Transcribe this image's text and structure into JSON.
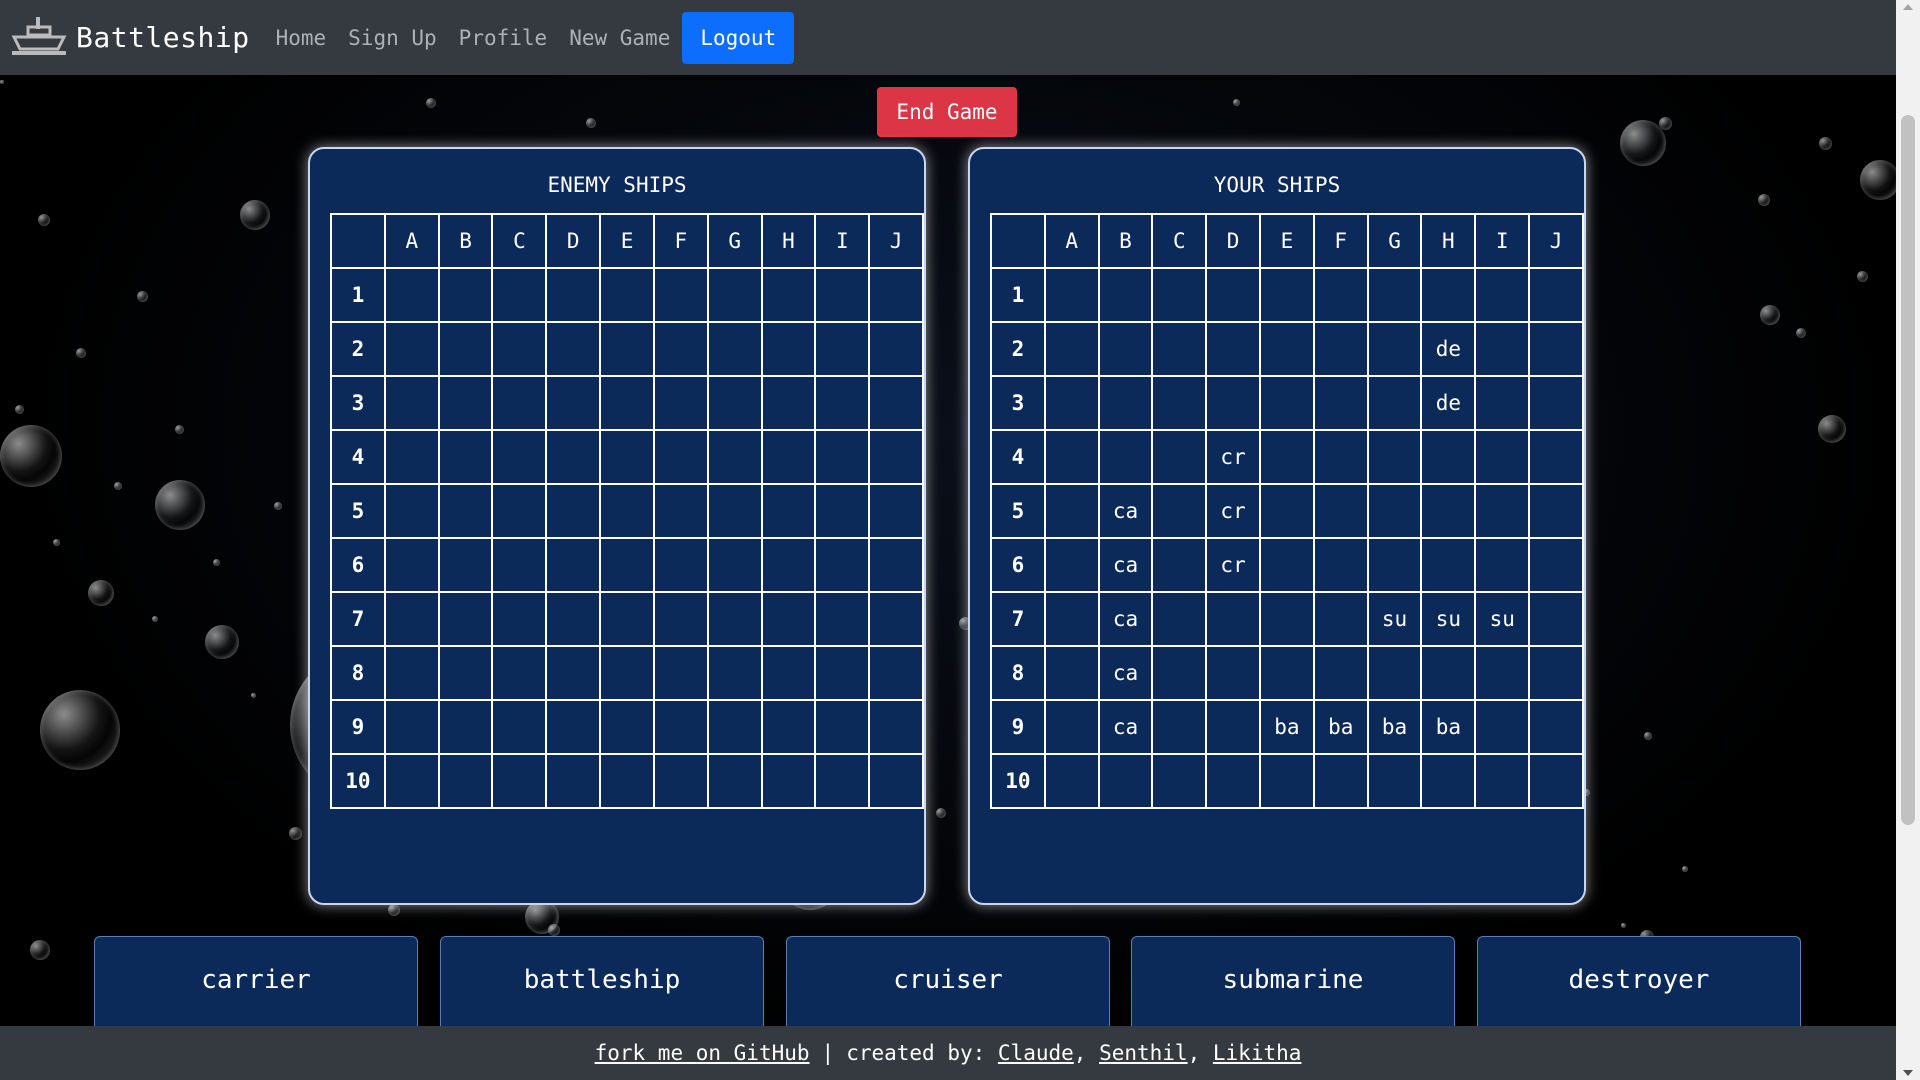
{
  "nav": {
    "brand": "Battleship",
    "links": [
      "Home",
      "Sign Up",
      "Profile",
      "New Game"
    ],
    "logout": "Logout"
  },
  "game": {
    "end_button": "End Game"
  },
  "boards": {
    "enemy": {
      "title": "ENEMY SHIPS",
      "columns": [
        "A",
        "B",
        "C",
        "D",
        "E",
        "F",
        "G",
        "H",
        "I",
        "J"
      ],
      "rows": [
        "1",
        "2",
        "3",
        "4",
        "5",
        "6",
        "7",
        "8",
        "9",
        "10"
      ],
      "cells": [
        [
          "",
          "",
          "",
          "",
          "",
          "",
          "",
          "",
          "",
          ""
        ],
        [
          "",
          "",
          "",
          "",
          "",
          "",
          "",
          "",
          "",
          ""
        ],
        [
          "",
          "",
          "",
          "",
          "",
          "",
          "",
          "",
          "",
          ""
        ],
        [
          "",
          "",
          "",
          "",
          "",
          "",
          "",
          "",
          "",
          ""
        ],
        [
          "",
          "",
          "",
          "",
          "",
          "",
          "",
          "",
          "",
          ""
        ],
        [
          "",
          "",
          "",
          "",
          "",
          "",
          "",
          "",
          "",
          ""
        ],
        [
          "",
          "",
          "",
          "",
          "",
          "",
          "",
          "",
          "",
          ""
        ],
        [
          "",
          "",
          "",
          "",
          "",
          "",
          "",
          "",
          "",
          ""
        ],
        [
          "",
          "",
          "",
          "",
          "",
          "",
          "",
          "",
          "",
          ""
        ],
        [
          "",
          "",
          "",
          "",
          "",
          "",
          "",
          "",
          "",
          ""
        ]
      ]
    },
    "yours": {
      "title": "YOUR SHIPS",
      "columns": [
        "A",
        "B",
        "C",
        "D",
        "E",
        "F",
        "G",
        "H",
        "I",
        "J"
      ],
      "rows": [
        "1",
        "2",
        "3",
        "4",
        "5",
        "6",
        "7",
        "8",
        "9",
        "10"
      ],
      "cells": [
        [
          "",
          "",
          "",
          "",
          "",
          "",
          "",
          "",
          "",
          ""
        ],
        [
          "",
          "",
          "",
          "",
          "",
          "",
          "",
          "de",
          "",
          ""
        ],
        [
          "",
          "",
          "",
          "",
          "",
          "",
          "",
          "de",
          "",
          ""
        ],
        [
          "",
          "",
          "",
          "cr",
          "",
          "",
          "",
          "",
          "",
          ""
        ],
        [
          "",
          "ca",
          "",
          "cr",
          "",
          "",
          "",
          "",
          "",
          ""
        ],
        [
          "",
          "ca",
          "",
          "cr",
          "",
          "",
          "",
          "",
          "",
          ""
        ],
        [
          "",
          "ca",
          "",
          "",
          "",
          "",
          "su",
          "su",
          "su",
          ""
        ],
        [
          "",
          "ca",
          "",
          "",
          "",
          "",
          "",
          "",
          "",
          ""
        ],
        [
          "",
          "ca",
          "",
          "",
          "ba",
          "ba",
          "ba",
          "ba",
          "",
          ""
        ],
        [
          "",
          "",
          "",
          "",
          "",
          "",
          "",
          "",
          "",
          ""
        ]
      ]
    }
  },
  "ships": [
    "carrier",
    "battleship",
    "cruiser",
    "submarine",
    "destroyer"
  ],
  "footer": {
    "github": "fork me on GitHub",
    "separator": "|",
    "created_by": "created by:",
    "authors": [
      "Claude",
      "Senthil",
      "Likitha"
    ]
  }
}
